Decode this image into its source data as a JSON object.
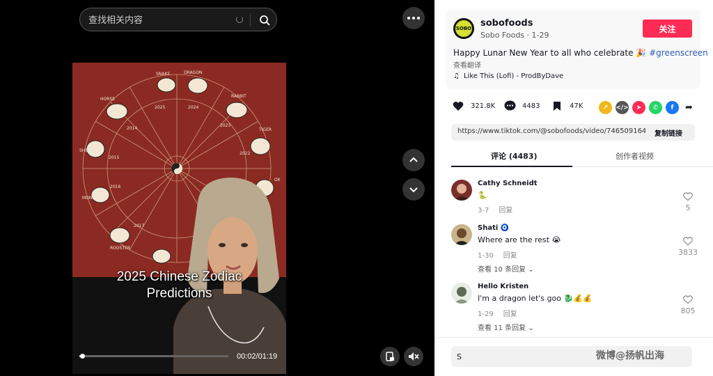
{
  "search": {
    "placeholder": "查找相关内容"
  },
  "video": {
    "caption_line1": "2025 Chinese Zodiac",
    "caption_line2": "Predictions",
    "progress_fraction": 0.021,
    "time": "00:02/01:19"
  },
  "zodiac_wheel": {
    "animals": [
      "SNAKE",
      "DRAGON",
      "RABBIT",
      "TIGER",
      "OX",
      "ROOSTER",
      "MONKEY",
      "SHEEP",
      "HORSE"
    ],
    "years": [
      "2025",
      "2024",
      "2023",
      "2022",
      "2021",
      "2017",
      "2016",
      "2015",
      "2014"
    ]
  },
  "author": {
    "username": "sobofoods",
    "subline": "Sobo Foods · 1-29",
    "avatar_text": "SOBO",
    "follow_label": "关注",
    "description": "Happy Lunar New Year to all who celebrate",
    "hashtag": "#greenscreen",
    "translate_label": "查看翻译",
    "music": "Like This (Lofi) - ProdByDave"
  },
  "stats": {
    "likes": "321.8K",
    "comments": "4483",
    "saves": "47K"
  },
  "share": {
    "link": "https://www.tiktok.com/@sobofoods/video/746509164...",
    "copy_label": "复制链接"
  },
  "tabs": {
    "comments": "评论 (4483)",
    "creator_videos": "创作者视频"
  },
  "comments": [
    {
      "name": "Cathy Schneidt",
      "text": "🐍",
      "date": "3-7",
      "reply": "回复",
      "likes": "5",
      "more": ""
    },
    {
      "name": "Shati 🧿",
      "text": "Where are the rest 😭",
      "date": "1-30",
      "reply": "回复",
      "likes": "3833",
      "more": "查看 10 条回复"
    },
    {
      "name": "Hello Kristen",
      "text": "I'm a dragon let's goo 🐉💰💰",
      "date": "1-29",
      "reply": "回复",
      "likes": "805",
      "more": "查看 11 条回复"
    }
  ],
  "comment_input": {
    "value": "S"
  },
  "watermark": "微博@扬帆出海",
  "colors": {
    "follow": "#fe2c55",
    "hashtag": "#2b5db9",
    "zodiac_bg": "#8b2a22"
  }
}
